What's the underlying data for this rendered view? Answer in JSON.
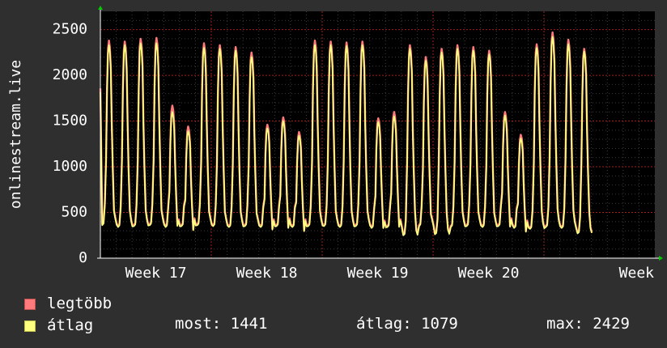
{
  "chart_data": {
    "type": "line",
    "ylabel": "onlinestream.live",
    "y_ticks": [
      0,
      500,
      1000,
      1500,
      2000,
      2500
    ],
    "ylim": [
      0,
      2700
    ],
    "x_tick_labels": [
      "Week 17",
      "Week 18",
      "Week 19",
      "Week 20",
      "Week"
    ],
    "x_unit": "days",
    "x_range_days": [
      0,
      35
    ],
    "grid": true,
    "background": "#000000",
    "grid_color": "#8a1f1f",
    "daily_peaks_legtobb": [
      2380,
      2370,
      2400,
      2410,
      1670,
      1440,
      2350,
      2330,
      2310,
      2250,
      1460,
      1540,
      1380,
      2380,
      2370,
      2360,
      2370,
      1530,
      1600,
      2330,
      2200,
      2290,
      2330,
      2310,
      2270,
      1600,
      1350,
      2340,
      2470,
      2390,
      2290
    ],
    "daily_peaks_atlag": [
      2330,
      2330,
      2350,
      2350,
      1600,
      1390,
      2300,
      2290,
      2270,
      2200,
      1420,
      1500,
      1340,
      2330,
      2330,
      2320,
      2330,
      1490,
      1550,
      2290,
      2160,
      2250,
      2290,
      2270,
      2230,
      1560,
      1310,
      2300,
      2420,
      2340,
      2260
    ],
    "daily_troughs_atlag": [
      360,
      340,
      350,
      360,
      340,
      350,
      360,
      350,
      340,
      350,
      340,
      350,
      340,
      350,
      350,
      340,
      350,
      330,
      340,
      250,
      350,
      260,
      340,
      350,
      340,
      350,
      330,
      320,
      340,
      330,
      270
    ],
    "series": [
      {
        "name": "legtöbb",
        "color": "#ff7a7a"
      },
      {
        "name": "átlag",
        "color": "#ffff80"
      }
    ]
  },
  "legend": {
    "items": [
      {
        "label": "legtöbb",
        "color": "#ff7a7a"
      },
      {
        "label": "átlag",
        "color": "#ffff80"
      }
    ],
    "stats": {
      "most_label": "most:",
      "most_value": "1441",
      "atlag_label": "átlag:",
      "atlag_value": "1079",
      "max_label": "max:",
      "max_value": "2429"
    }
  }
}
